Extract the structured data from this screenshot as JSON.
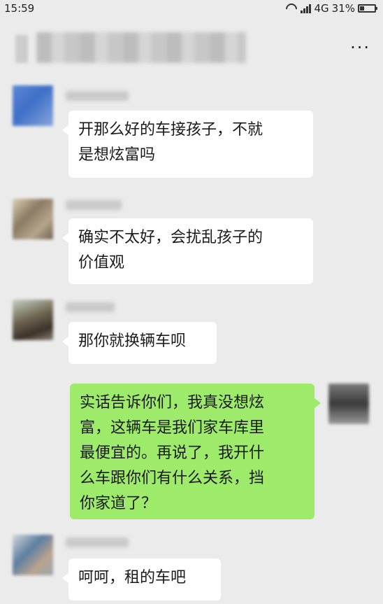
{
  "status_bar": {
    "time": "15:59",
    "network": "4G",
    "battery": "31%",
    "battery_level": 0.31
  },
  "nav": {
    "more_label": "···"
  },
  "messages": [
    {
      "side": "left",
      "text": "开那么好的车接孩子，不就\n是想炫富吗"
    },
    {
      "side": "left",
      "text": "确实不太好，会扰乱孩子的\n价值观"
    },
    {
      "side": "left",
      "text": "那你就换辆车呗"
    },
    {
      "side": "right",
      "text": "实话告诉你们，我真没想炫\n富，这辆车是我们家车库里\n最便宜的。再说了，我开什\n么车跟你们有什么关系，挡\n你家道了？"
    },
    {
      "side": "left",
      "text": "呵呵，租的车吧"
    }
  ],
  "colors": {
    "background": "#ebebeb",
    "bubble_left": "#ffffff",
    "bubble_self": "#9eea6a"
  }
}
